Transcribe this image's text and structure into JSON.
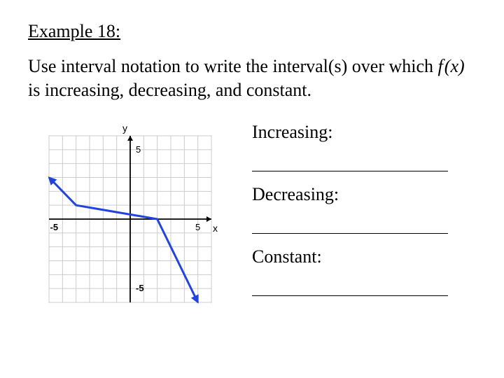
{
  "heading": "Example 18:",
  "prompt_before_fx": "Use interval notation to write the interval(s) over which ",
  "fx_expr_prefix": "f",
  "fx_expr_arg": "(x)",
  "prompt_after_fx": " is increasing, decreasing, and constant.",
  "answers": {
    "inc_label": "Increasing:",
    "dec_label": "Decreasing:",
    "const_label": "Constant:"
  },
  "chart_data": {
    "type": "line",
    "title": "",
    "xlabel": "x",
    "ylabel": "y",
    "xlim": [
      -6,
      6
    ],
    "ylim": [
      -6,
      6
    ],
    "x_tick": {
      "value": 5,
      "label": "5"
    },
    "y_tick": {
      "value": 5,
      "label": "5"
    },
    "neg_x_tick": {
      "value": -5,
      "label": "-5"
    },
    "neg_y_tick": {
      "value": -5,
      "label": "-5"
    },
    "series": [
      {
        "name": "f(x)",
        "color": "#2244dd",
        "points": [
          {
            "x": -6,
            "y": 3
          },
          {
            "x": -4,
            "y": 1
          },
          {
            "x": 2,
            "y": 0
          },
          {
            "x": 5,
            "y": -6
          }
        ],
        "arrow_start": true,
        "arrow_end": true
      }
    ]
  }
}
